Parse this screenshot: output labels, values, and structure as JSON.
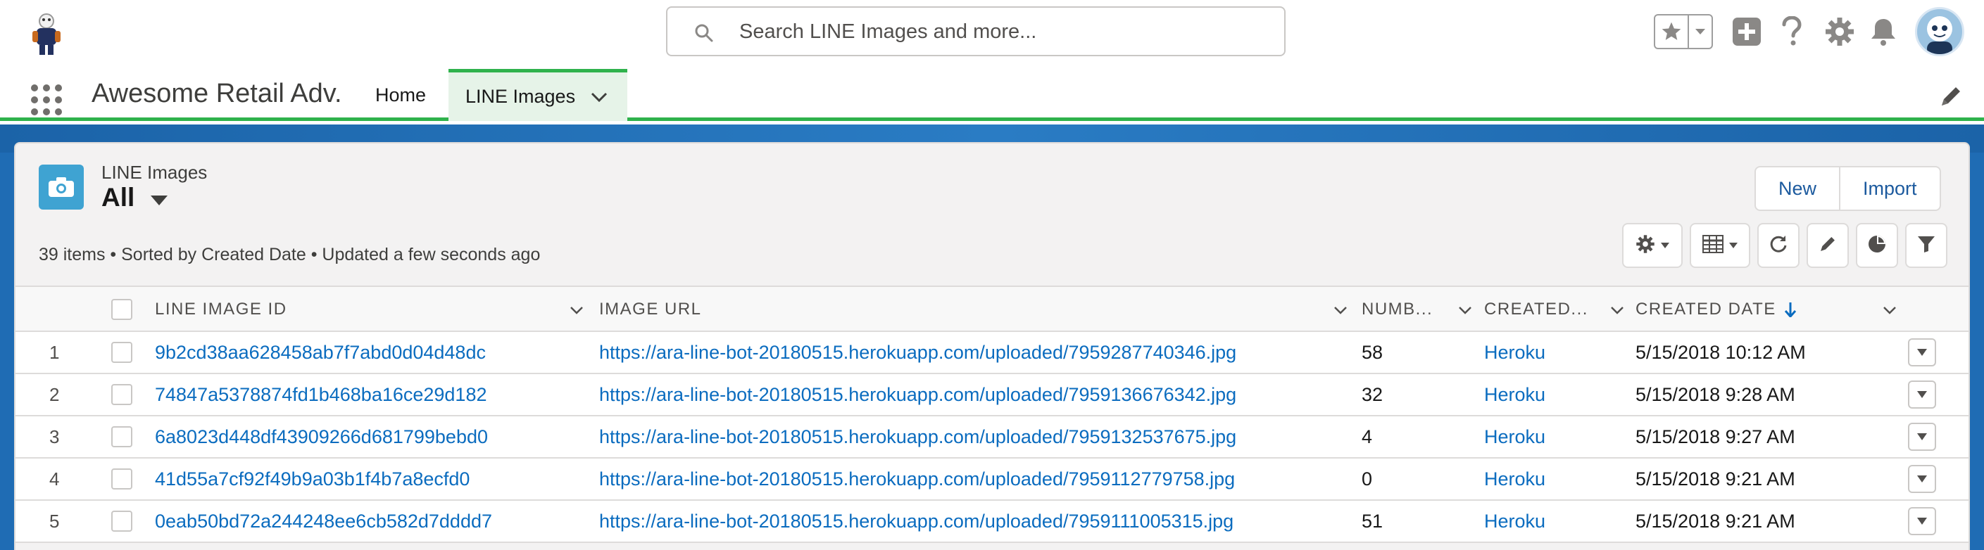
{
  "colors": {
    "accent": "#2fb24c",
    "link": "#0b6cbf",
    "object_icon": "#3fa3d2",
    "banner": "#1f6cb4"
  },
  "search": {
    "placeholder": "Search LINE Images and more..."
  },
  "header_icons": [
    "star-icon",
    "chevron-down-icon",
    "add-icon",
    "help-icon",
    "gear-icon",
    "bell-icon",
    "avatar"
  ],
  "nav": {
    "app_name": "Awesome Retail Adv.",
    "tabs": [
      {
        "label": "Home",
        "active": false
      },
      {
        "label": "LINE Images",
        "active": true
      }
    ]
  },
  "list_view": {
    "object_label": "LINE Images",
    "list_name": "All",
    "buttons": {
      "new": "New",
      "import": "Import"
    },
    "status": "39 items • Sorted by Created Date • Updated a few seconds ago",
    "toolbar_icons": [
      "gear-icon",
      "table-icon",
      "refresh-icon",
      "pencil-icon",
      "pie-chart-icon",
      "filter-icon"
    ]
  },
  "table": {
    "columns": [
      "LINE IMAGE ID",
      "IMAGE URL",
      "NUMB...",
      "CREATED...",
      "CREATED DATE"
    ],
    "sort_column": "CREATED DATE",
    "sort_direction": "descending",
    "rows": [
      {
        "num": "1",
        "id": "9b2cd38aa628458ab7f7abd0d04d48dc",
        "url": "https://ara-line-bot-20180515.herokuapp.com/uploaded/7959287740346.jpg",
        "number": "58",
        "created_by": "Heroku",
        "created_date": "5/15/2018 10:12 AM"
      },
      {
        "num": "2",
        "id": "74847a5378874fd1b468ba16ce29d182",
        "url": "https://ara-line-bot-20180515.herokuapp.com/uploaded/7959136676342.jpg",
        "number": "32",
        "created_by": "Heroku",
        "created_date": "5/15/2018 9:28 AM"
      },
      {
        "num": "3",
        "id": "6a8023d448df43909266d681799bebd0",
        "url": "https://ara-line-bot-20180515.herokuapp.com/uploaded/7959132537675.jpg",
        "number": "4",
        "created_by": "Heroku",
        "created_date": "5/15/2018 9:27 AM"
      },
      {
        "num": "4",
        "id": "41d55a7cf92f49b9a03b1f4b7a8ecfd0",
        "url": "https://ara-line-bot-20180515.herokuapp.com/uploaded/7959112779758.jpg",
        "number": "0",
        "created_by": "Heroku",
        "created_date": "5/15/2018 9:21 AM"
      },
      {
        "num": "5",
        "id": "0eab50bd72a244248ee6cb582d7dddd7",
        "url": "https://ara-line-bot-20180515.herokuapp.com/uploaded/7959111005315.jpg",
        "number": "51",
        "created_by": "Heroku",
        "created_date": "5/15/2018 9:21 AM"
      }
    ]
  }
}
